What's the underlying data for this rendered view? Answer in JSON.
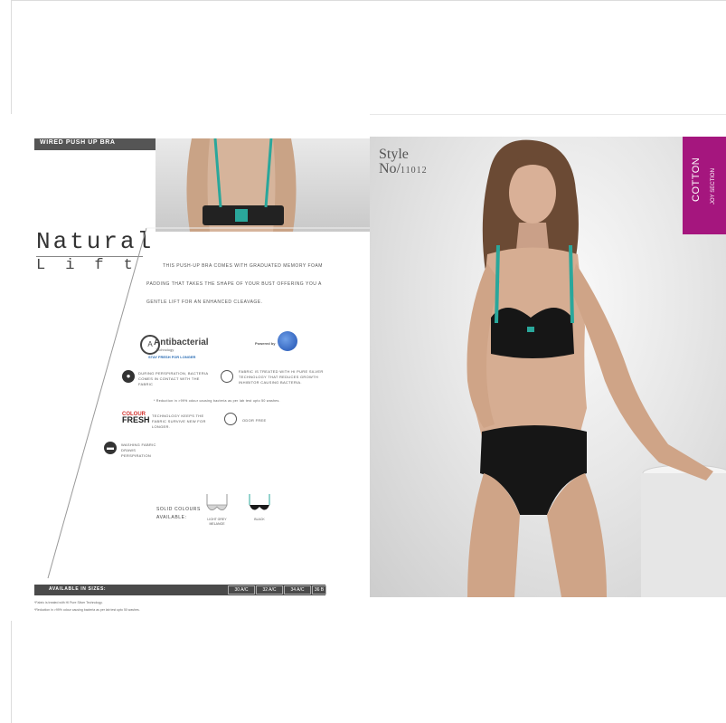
{
  "left_page": {
    "header": "WIRED PUSH UP BRA",
    "title_main": "Natural",
    "title_sub": "Lift",
    "description": "THIS PUSH-UP BRA COMES WITH GRADUATED MEMORY FOAM PADDING THAT TAKES THE SHAPE OF YOUR BUST OFFERING YOU A GENTLE LIFT FOR AN ENHANCED CLEAVAGE.",
    "antibacterial": {
      "title": "Antibacterial",
      "subtitle": "Technology",
      "tagline": "STAY FRESH FOR LONGER",
      "powered_by": "Powered by"
    },
    "features": [
      "DURING PERSPIRATION, BACTERIA COMES IN CONTACT WITH THE FABRIC",
      "FABRIC IS TREATED WITH HI PURE SILVER TECHNOLOGY THAT REDUCES GROWTH INHIBITOR CAUSING BACTERIA.",
      "TECHNOLOGY KEEPS THE FABRIC SURVIVE NEW FOR LONGER.",
      "ODOR FREE",
      "WASHING FABRIC DRAWS PERSPIRATION"
    ],
    "fineprint_mid": "* Reduction in >99% odour causing bacteria as per lab test upto 50 washes.",
    "fresh_logo": {
      "line1": "COLOUR",
      "line2": "FRESH"
    },
    "colours": {
      "label_line1": "SOLID COLOURS",
      "label_line2": "AVAILABLE:",
      "swatches": [
        {
          "name_line1": "LIGHT GREY",
          "name_line2": "MELANGE"
        },
        {
          "name_line1": "BLACK",
          "name_line2": ""
        }
      ]
    },
    "sizes": {
      "label": "AVAILABLE IN SIZES:",
      "values": [
        "30 A/C",
        "32 A/C",
        "34 A/C",
        "36 B"
      ]
    },
    "notes": [
      "*Fabric is treated with HI Pure Silver Technology.",
      "*Reduction in >99% odour causing bacteria as per lab test upto 50 washes."
    ]
  },
  "right_page": {
    "style_label_1": "Style",
    "style_label_2": "No",
    "style_number": "11012",
    "brand_main": "COTTON",
    "brand_sub": "JOY SECTION"
  },
  "colors": {
    "accent_teal": "#2aa79b",
    "brand_magenta": "#a5167e",
    "header_gray": "#555555"
  }
}
